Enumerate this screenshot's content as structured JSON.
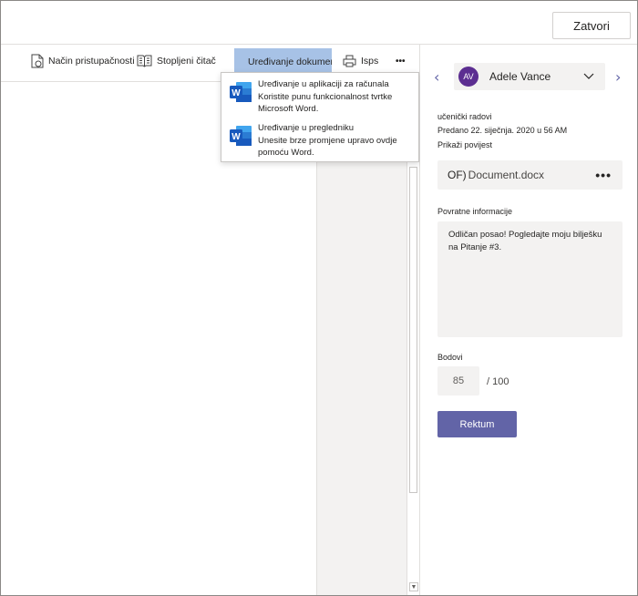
{
  "header": {
    "close_label": "Zatvori"
  },
  "toolbar": {
    "accessibility_label": "Način pristupačnosti",
    "immersive_reader_label": "Stopljeni čitač",
    "edit_document_label": "Uređivanje dokumenta",
    "print_label": "Isps",
    "more_label": "•••"
  },
  "edit_menu": {
    "items": [
      {
        "title": "Uređivanje u aplikaciji za računala",
        "description": "Koristite punu funkcionalnost tvrtke Microsoft Word."
      },
      {
        "title": "Uređivanje u pregledniku",
        "description": "Unesite brze promjene upravo ovdje pomoću Word."
      }
    ]
  },
  "panel": {
    "student": {
      "initials": "AV",
      "name": "Adele Vance",
      "avatar_color": "#5c2e91"
    },
    "prev_arrow": "‹",
    "next_arrow": "›",
    "section_label": "učenički radovi",
    "submitted_text": "Predano 22. siječnja. 2020 u 56 AM",
    "history_link": "Prikaži povijest",
    "file": {
      "prefix": "OF)",
      "name": "Document.docx",
      "more_label": "•••"
    },
    "feedback_label": "Povratne informacije",
    "feedback_text": "Odličan posao! Pogledajte moju bilješku na Pitanje #3.",
    "points_label": "Bodovi",
    "points_value": "85",
    "points_max": "/ 100",
    "return_label": "Rektum"
  },
  "colors": {
    "accent": "#6264a7",
    "active_toolbar": "#a7c2e6",
    "word_blue": "#185abd"
  }
}
